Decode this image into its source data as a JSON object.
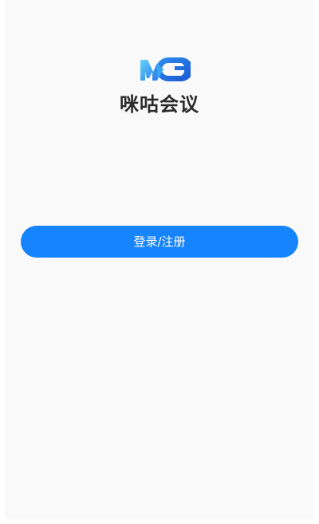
{
  "app": {
    "name": "咪咕会议"
  },
  "logo": {
    "icon": "migu-logo-icon",
    "colors": {
      "light": "#58c8f8",
      "dark": "#1f5fd8"
    }
  },
  "actions": {
    "login_register_label": "登录/注册"
  },
  "colors": {
    "accent": "#1684fc",
    "background": "#f9f9f9",
    "title": "#2b2b2b"
  }
}
